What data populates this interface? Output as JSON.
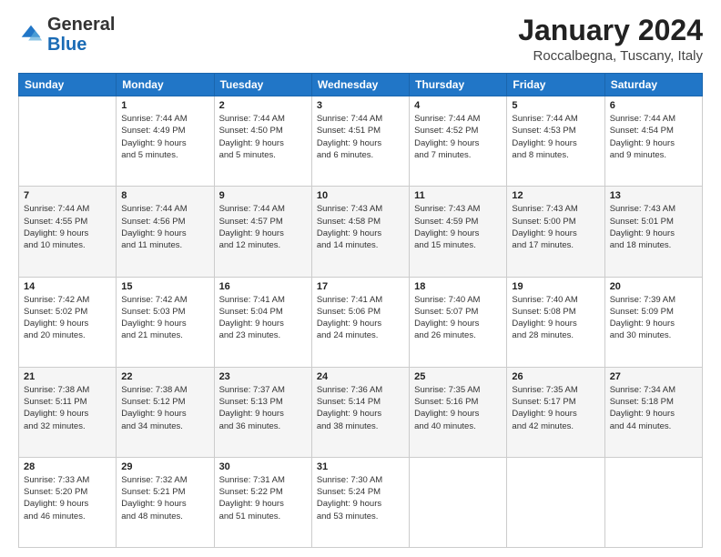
{
  "header": {
    "logo_general": "General",
    "logo_blue": "Blue",
    "month_title": "January 2024",
    "location": "Roccalbegna, Tuscany, Italy"
  },
  "days_of_week": [
    "Sunday",
    "Monday",
    "Tuesday",
    "Wednesday",
    "Thursday",
    "Friday",
    "Saturday"
  ],
  "weeks": [
    [
      {
        "day": "",
        "info": ""
      },
      {
        "day": "1",
        "info": "Sunrise: 7:44 AM\nSunset: 4:49 PM\nDaylight: 9 hours\nand 5 minutes."
      },
      {
        "day": "2",
        "info": "Sunrise: 7:44 AM\nSunset: 4:50 PM\nDaylight: 9 hours\nand 5 minutes."
      },
      {
        "day": "3",
        "info": "Sunrise: 7:44 AM\nSunset: 4:51 PM\nDaylight: 9 hours\nand 6 minutes."
      },
      {
        "day": "4",
        "info": "Sunrise: 7:44 AM\nSunset: 4:52 PM\nDaylight: 9 hours\nand 7 minutes."
      },
      {
        "day": "5",
        "info": "Sunrise: 7:44 AM\nSunset: 4:53 PM\nDaylight: 9 hours\nand 8 minutes."
      },
      {
        "day": "6",
        "info": "Sunrise: 7:44 AM\nSunset: 4:54 PM\nDaylight: 9 hours\nand 9 minutes."
      }
    ],
    [
      {
        "day": "7",
        "info": "Sunrise: 7:44 AM\nSunset: 4:55 PM\nDaylight: 9 hours\nand 10 minutes."
      },
      {
        "day": "8",
        "info": "Sunrise: 7:44 AM\nSunset: 4:56 PM\nDaylight: 9 hours\nand 11 minutes."
      },
      {
        "day": "9",
        "info": "Sunrise: 7:44 AM\nSunset: 4:57 PM\nDaylight: 9 hours\nand 12 minutes."
      },
      {
        "day": "10",
        "info": "Sunrise: 7:43 AM\nSunset: 4:58 PM\nDaylight: 9 hours\nand 14 minutes."
      },
      {
        "day": "11",
        "info": "Sunrise: 7:43 AM\nSunset: 4:59 PM\nDaylight: 9 hours\nand 15 minutes."
      },
      {
        "day": "12",
        "info": "Sunrise: 7:43 AM\nSunset: 5:00 PM\nDaylight: 9 hours\nand 17 minutes."
      },
      {
        "day": "13",
        "info": "Sunrise: 7:43 AM\nSunset: 5:01 PM\nDaylight: 9 hours\nand 18 minutes."
      }
    ],
    [
      {
        "day": "14",
        "info": "Sunrise: 7:42 AM\nSunset: 5:02 PM\nDaylight: 9 hours\nand 20 minutes."
      },
      {
        "day": "15",
        "info": "Sunrise: 7:42 AM\nSunset: 5:03 PM\nDaylight: 9 hours\nand 21 minutes."
      },
      {
        "day": "16",
        "info": "Sunrise: 7:41 AM\nSunset: 5:04 PM\nDaylight: 9 hours\nand 23 minutes."
      },
      {
        "day": "17",
        "info": "Sunrise: 7:41 AM\nSunset: 5:06 PM\nDaylight: 9 hours\nand 24 minutes."
      },
      {
        "day": "18",
        "info": "Sunrise: 7:40 AM\nSunset: 5:07 PM\nDaylight: 9 hours\nand 26 minutes."
      },
      {
        "day": "19",
        "info": "Sunrise: 7:40 AM\nSunset: 5:08 PM\nDaylight: 9 hours\nand 28 minutes."
      },
      {
        "day": "20",
        "info": "Sunrise: 7:39 AM\nSunset: 5:09 PM\nDaylight: 9 hours\nand 30 minutes."
      }
    ],
    [
      {
        "day": "21",
        "info": "Sunrise: 7:38 AM\nSunset: 5:11 PM\nDaylight: 9 hours\nand 32 minutes."
      },
      {
        "day": "22",
        "info": "Sunrise: 7:38 AM\nSunset: 5:12 PM\nDaylight: 9 hours\nand 34 minutes."
      },
      {
        "day": "23",
        "info": "Sunrise: 7:37 AM\nSunset: 5:13 PM\nDaylight: 9 hours\nand 36 minutes."
      },
      {
        "day": "24",
        "info": "Sunrise: 7:36 AM\nSunset: 5:14 PM\nDaylight: 9 hours\nand 38 minutes."
      },
      {
        "day": "25",
        "info": "Sunrise: 7:35 AM\nSunset: 5:16 PM\nDaylight: 9 hours\nand 40 minutes."
      },
      {
        "day": "26",
        "info": "Sunrise: 7:35 AM\nSunset: 5:17 PM\nDaylight: 9 hours\nand 42 minutes."
      },
      {
        "day": "27",
        "info": "Sunrise: 7:34 AM\nSunset: 5:18 PM\nDaylight: 9 hours\nand 44 minutes."
      }
    ],
    [
      {
        "day": "28",
        "info": "Sunrise: 7:33 AM\nSunset: 5:20 PM\nDaylight: 9 hours\nand 46 minutes."
      },
      {
        "day": "29",
        "info": "Sunrise: 7:32 AM\nSunset: 5:21 PM\nDaylight: 9 hours\nand 48 minutes."
      },
      {
        "day": "30",
        "info": "Sunrise: 7:31 AM\nSunset: 5:22 PM\nDaylight: 9 hours\nand 51 minutes."
      },
      {
        "day": "31",
        "info": "Sunrise: 7:30 AM\nSunset: 5:24 PM\nDaylight: 9 hours\nand 53 minutes."
      },
      {
        "day": "",
        "info": ""
      },
      {
        "day": "",
        "info": ""
      },
      {
        "day": "",
        "info": ""
      }
    ]
  ]
}
